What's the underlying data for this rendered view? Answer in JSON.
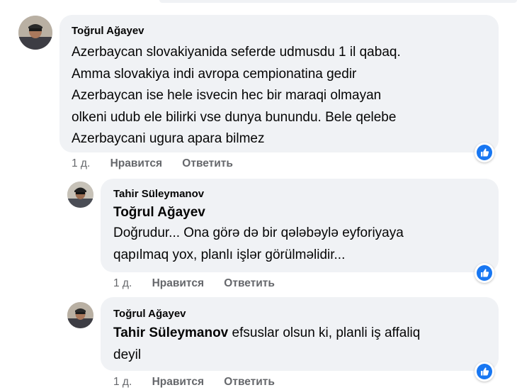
{
  "comments": [
    {
      "author": "Toğrul Ağayev",
      "lines": [
        "Azerbaycan slovakiyanida seferde udmusdu 1 il qabaq.",
        "Amma slovakiya indi avropa cempionatina gedir",
        "Azerbaycan ise hele isvecin hec bir maraqi olmayan",
        "olkeni udub ele bilirki vse dunya bunundu. Bele qelebe",
        "Azerbaycani ugura apara bilmez"
      ],
      "time": "1 д.",
      "like_label": "Нравится",
      "reply_label": "Ответить",
      "reaction": "like-icon"
    },
    {
      "author": "Tahir Süleymanov",
      "mention": "Toğrul Ağayev",
      "lines": [
        "Doğrudur... Ona görə də bir qələbəylə eyforiyaya",
        "qapılmaq yox, planlı işlər görülməlidir..."
      ],
      "time": "1 д.",
      "like_label": "Нравится",
      "reply_label": "Ответить",
      "reaction": "like-icon"
    },
    {
      "author": "Toğrul Ağayev",
      "mention": "Tahir Süleymanov",
      "first_line_rest": "efsuslar olsun ki, planli iş affaliq",
      "lines": [
        "deyil"
      ],
      "time": "1 д.",
      "like_label": "Нравится",
      "reply_label": "Ответить",
      "reaction": "like-icon"
    }
  ],
  "colors": {
    "bubble": "#f0f2f5",
    "meta_text": "#65676b",
    "like_blue": "#1877f2"
  }
}
